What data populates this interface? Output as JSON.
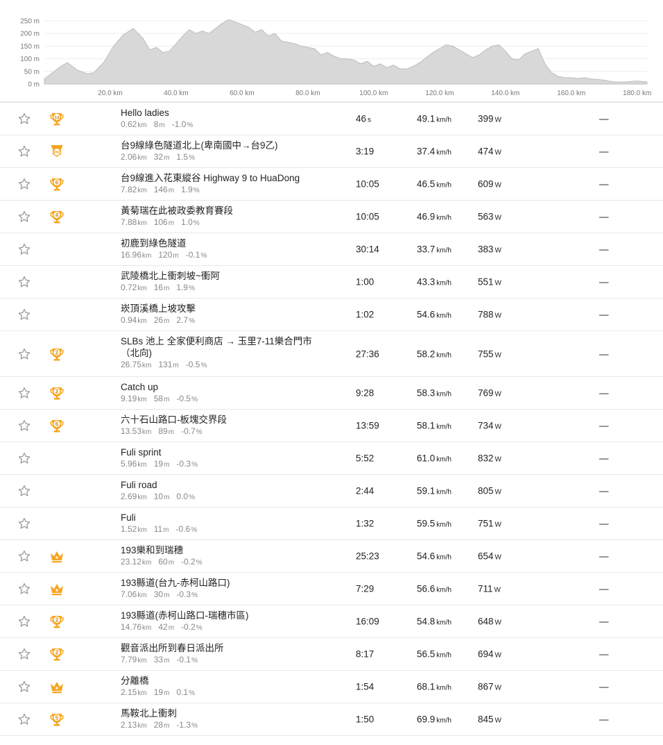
{
  "chart_data": {
    "type": "area",
    "y_ticks": [
      "250 m",
      "200 m",
      "150 m",
      "100 m",
      "50 m",
      "0 m"
    ],
    "x_ticks": [
      "20.0 km",
      "40.0 km",
      "60.0 km",
      "80.0 km",
      "100.0 km",
      "120.0 km",
      "140.0 km",
      "160.0 km",
      "180.0 km"
    ],
    "xlim": [
      0,
      183
    ],
    "ylim": [
      0,
      250
    ],
    "fill_color": "#d8d8d8",
    "profile": {
      "x": [
        0,
        2,
        5,
        7,
        10,
        13,
        15,
        18,
        21,
        24,
        27,
        30,
        32,
        34,
        36,
        38,
        40,
        42,
        44,
        46,
        48,
        50,
        52,
        54,
        56,
        58,
        60,
        62,
        64,
        66,
        68,
        70,
        72,
        74,
        76,
        78,
        80,
        82,
        84,
        86,
        88,
        90,
        92,
        94,
        96,
        98,
        100,
        102,
        104,
        106,
        108,
        110,
        112,
        114,
        116,
        118,
        120,
        122,
        124,
        126,
        128,
        130,
        132,
        134,
        136,
        138,
        140,
        142,
        144,
        146,
        148,
        150,
        152,
        154,
        156,
        158,
        160,
        162,
        164,
        166,
        168,
        170,
        172,
        174,
        176,
        178,
        180,
        183
      ],
      "y": [
        20,
        40,
        70,
        85,
        55,
        40,
        45,
        85,
        150,
        195,
        220,
        180,
        135,
        145,
        125,
        130,
        160,
        190,
        215,
        200,
        210,
        200,
        220,
        240,
        255,
        245,
        235,
        225,
        205,
        215,
        190,
        200,
        170,
        165,
        160,
        150,
        145,
        140,
        115,
        125,
        110,
        100,
        100,
        95,
        80,
        90,
        70,
        80,
        65,
        75,
        60,
        60,
        70,
        85,
        105,
        125,
        140,
        155,
        150,
        135,
        120,
        105,
        115,
        135,
        150,
        155,
        130,
        100,
        95,
        120,
        130,
        140,
        80,
        45,
        30,
        25,
        25,
        22,
        25,
        20,
        18,
        15,
        10,
        8,
        8,
        10,
        12,
        8
      ]
    }
  },
  "segments": [
    {
      "name": "Hello ladies",
      "dist": "0.62",
      "dist_u": "km",
      "elev": "8",
      "elev_u": "m",
      "grade": "-1.0",
      "grade_u": "%",
      "time": "46",
      "time_u": "s",
      "speed": "49.1",
      "speed_u": "km/h",
      "power": "399",
      "power_u": "W",
      "dash": "—",
      "award": "trophy-10"
    },
    {
      "name": "台9線綠色隧道北上(卑南國中→台9乙)",
      "dist": "2.06",
      "dist_u": "km",
      "elev": "32",
      "elev_u": "m",
      "grade": "1.5",
      "grade_u": "%",
      "time": "3:19",
      "time_u": "",
      "speed": "37.4",
      "speed_u": "km/h",
      "power": "474",
      "power_u": "W",
      "dash": "—",
      "award": "pr"
    },
    {
      "name": "台9線進入花東縱谷 Highway 9 to HuaDong",
      "dist": "7.82",
      "dist_u": "km",
      "elev": "146",
      "elev_u": "m",
      "grade": "1.9",
      "grade_u": "%",
      "time": "10:05",
      "time_u": "",
      "speed": "46.5",
      "speed_u": "km/h",
      "power": "609",
      "power_u": "W",
      "dash": "—",
      "award": "trophy-6"
    },
    {
      "name": "黃菊瑞在此被政委教育賽段",
      "dist": "7.88",
      "dist_u": "km",
      "elev": "106",
      "elev_u": "m",
      "grade": "1.0",
      "grade_u": "%",
      "time": "10:05",
      "time_u": "",
      "speed": "46.9",
      "speed_u": "km/h",
      "power": "563",
      "power_u": "W",
      "dash": "—",
      "award": "trophy-4"
    },
    {
      "name": "初鹿到綠色隧道",
      "dist": "16.96",
      "dist_u": "km",
      "elev": "120",
      "elev_u": "m",
      "grade": "-0.1",
      "grade_u": "%",
      "time": "30:14",
      "time_u": "",
      "speed": "33.7",
      "speed_u": "km/h",
      "power": "383",
      "power_u": "W",
      "dash": "—",
      "award": ""
    },
    {
      "name": "武陵橋北上衝刺坡~衝阿",
      "dist": "0.72",
      "dist_u": "km",
      "elev": "16",
      "elev_u": "m",
      "grade": "1.9",
      "grade_u": "%",
      "time": "1:00",
      "time_u": "",
      "speed": "43.3",
      "speed_u": "km/h",
      "power": "551",
      "power_u": "W",
      "dash": "—",
      "award": ""
    },
    {
      "name": "崁頂溪橋上坡攻擊",
      "dist": "0.94",
      "dist_u": "km",
      "elev": "26",
      "elev_u": "m",
      "grade": "2.7",
      "grade_u": "%",
      "time": "1:02",
      "time_u": "",
      "speed": "54.6",
      "speed_u": "km/h",
      "power": "788",
      "power_u": "W",
      "dash": "—",
      "award": ""
    },
    {
      "name": "SLBs 池上 全家便利商店 → 玉里7-11樂合門市（北向)",
      "dist": "26.75",
      "dist_u": "km",
      "elev": "131",
      "elev_u": "m",
      "grade": "-0.5",
      "grade_u": "%",
      "time": "27:36",
      "time_u": "",
      "speed": "58.2",
      "speed_u": "km/h",
      "power": "755",
      "power_u": "W",
      "dash": "—",
      "award": "trophy-2",
      "tall": true
    },
    {
      "name": "Catch up",
      "dist": "9.19",
      "dist_u": "km",
      "elev": "58",
      "elev_u": "m",
      "grade": "-0.5",
      "grade_u": "%",
      "time": "9:28",
      "time_u": "",
      "speed": "58.3",
      "speed_u": "km/h",
      "power": "769",
      "power_u": "W",
      "dash": "—",
      "award": "trophy-2"
    },
    {
      "name": "六十石山路口-板塊交界段",
      "dist": "13.53",
      "dist_u": "km",
      "elev": "89",
      "elev_u": "m",
      "grade": "-0.7",
      "grade_u": "%",
      "time": "13:59",
      "time_u": "",
      "speed": "58.1",
      "speed_u": "km/h",
      "power": "734",
      "power_u": "W",
      "dash": "—",
      "award": "trophy-6"
    },
    {
      "name": "Fuli sprint",
      "dist": "5.96",
      "dist_u": "km",
      "elev": "19",
      "elev_u": "m",
      "grade": "-0.3",
      "grade_u": "%",
      "time": "5:52",
      "time_u": "",
      "speed": "61.0",
      "speed_u": "km/h",
      "power": "832",
      "power_u": "W",
      "dash": "—",
      "award": ""
    },
    {
      "name": "Fuli road",
      "dist": "2.69",
      "dist_u": "km",
      "elev": "10",
      "elev_u": "m",
      "grade": "0.0",
      "grade_u": "%",
      "time": "2:44",
      "time_u": "",
      "speed": "59.1",
      "speed_u": "km/h",
      "power": "805",
      "power_u": "W",
      "dash": "—",
      "award": ""
    },
    {
      "name": "Fuli",
      "dist": "1.52",
      "dist_u": "km",
      "elev": "11",
      "elev_u": "m",
      "grade": "-0.6",
      "grade_u": "%",
      "time": "1:32",
      "time_u": "",
      "speed": "59.5",
      "speed_u": "km/h",
      "power": "751",
      "power_u": "W",
      "dash": "—",
      "award": ""
    },
    {
      "name": "193樂和到瑞穗",
      "dist": "23.12",
      "dist_u": "km",
      "elev": "60",
      "elev_u": "m",
      "grade": "-0.2",
      "grade_u": "%",
      "time": "25:23",
      "time_u": "",
      "speed": "54.6",
      "speed_u": "km/h",
      "power": "654",
      "power_u": "W",
      "dash": "—",
      "award": "crown"
    },
    {
      "name": "193縣道(台九-赤柯山路口)",
      "dist": "7.06",
      "dist_u": "km",
      "elev": "30",
      "elev_u": "m",
      "grade": "-0.3",
      "grade_u": "%",
      "time": "7:29",
      "time_u": "",
      "speed": "56.6",
      "speed_u": "km/h",
      "power": "711",
      "power_u": "W",
      "dash": "—",
      "award": "crown"
    },
    {
      "name": "193縣道(赤柯山路口-瑞穗市區)",
      "dist": "14.76",
      "dist_u": "km",
      "elev": "42",
      "elev_u": "m",
      "grade": "-0.2",
      "grade_u": "%",
      "time": "16:09",
      "time_u": "",
      "speed": "54.8",
      "speed_u": "km/h",
      "power": "648",
      "power_u": "W",
      "dash": "—",
      "award": "trophy-2"
    },
    {
      "name": "觀音派出所到春日派出所",
      "dist": "7.79",
      "dist_u": "km",
      "elev": "33",
      "elev_u": "m",
      "grade": "-0.1",
      "grade_u": "%",
      "time": "8:17",
      "time_u": "",
      "speed": "56.5",
      "speed_u": "km/h",
      "power": "694",
      "power_u": "W",
      "dash": "—",
      "award": "trophy-2"
    },
    {
      "name": "分離橋",
      "dist": "2.15",
      "dist_u": "km",
      "elev": "19",
      "elev_u": "m",
      "grade": "0.1",
      "grade_u": "%",
      "time": "1:54",
      "time_u": "",
      "speed": "68.1",
      "speed_u": "km/h",
      "power": "867",
      "power_u": "W",
      "dash": "—",
      "award": "crown"
    },
    {
      "name": "馬鞍北上衝刺",
      "dist": "2.13",
      "dist_u": "km",
      "elev": "28",
      "elev_u": "m",
      "grade": "-1.3",
      "grade_u": "%",
      "time": "1:50",
      "time_u": "",
      "speed": "69.9",
      "speed_u": "km/h",
      "power": "845",
      "power_u": "W",
      "dash": "—",
      "award": "trophy-5"
    }
  ],
  "colors": {
    "gold": "#f5a623",
    "gold_dark": "#d98a0c",
    "star": "#9a9a9a",
    "fill": "#d8d8d8",
    "stroke": "#bdbdbd"
  }
}
